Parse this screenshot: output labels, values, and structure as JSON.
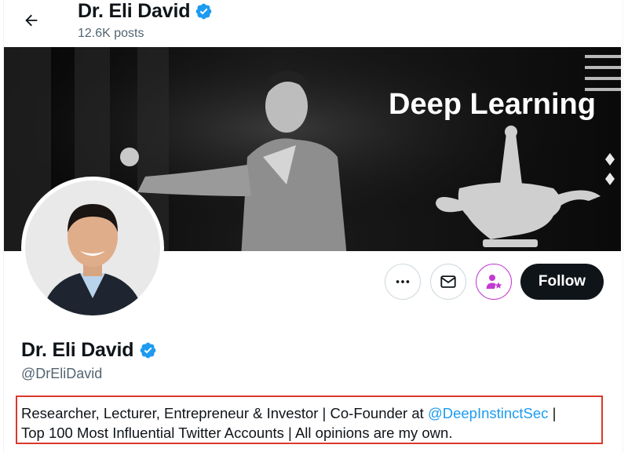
{
  "header": {
    "title": "Dr. Eli David",
    "posts_count": "12.6K posts"
  },
  "banner": {
    "text": "Deep Learning"
  },
  "profile": {
    "name": "Dr. Eli David",
    "handle": "@DrEliDavid",
    "bio": {
      "part1": "Researcher, Lecturer, Entrepreneur & Investor | Co-Founder at ",
      "mention": "@DeepInstinctSec",
      "part2": " |",
      "line2": "Top 100 Most Influential Twitter Accounts | All opinions are my own."
    }
  },
  "actions": {
    "follow_label": "Follow",
    "more_icon": "more-icon",
    "message_icon": "envelope-icon",
    "subscribe_icon": "person-star-icon"
  },
  "colors": {
    "verified": "#1d9bf0",
    "follow_bg": "#0f1419",
    "link": "#1d9bf0",
    "subscribe_accent": "#c23ad1",
    "highlight_box": "#d93a2b"
  }
}
